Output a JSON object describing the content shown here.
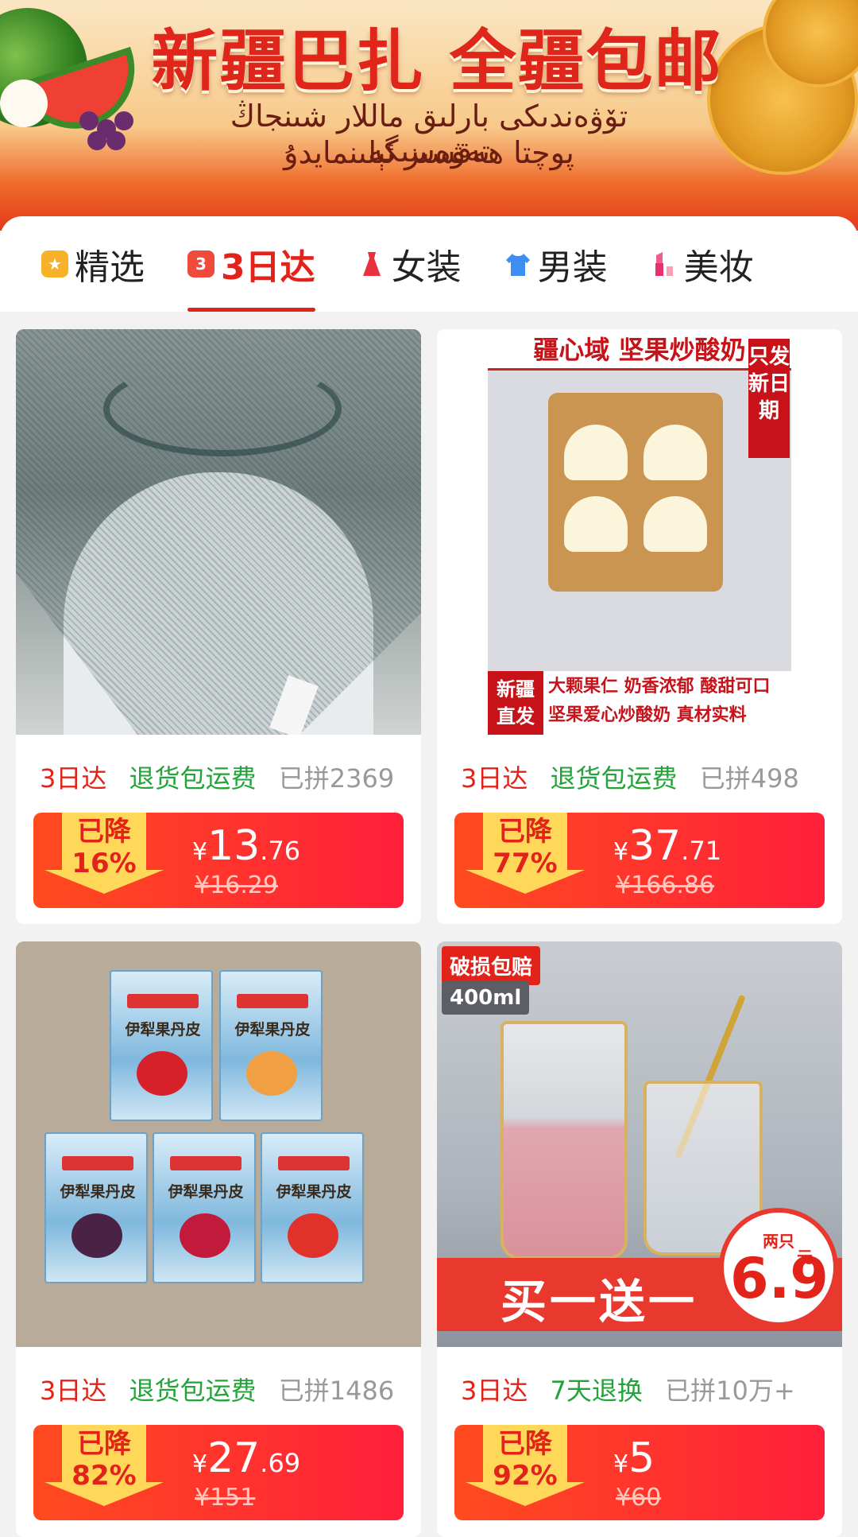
{
  "banner": {
    "title": "新疆巴扎 全疆包邮",
    "uyghur_line1": "تۆۋەندىكى بارلىق ماللار شىنجاڭ تەۋەسىگە",
    "uyghur_line2": "پوچتا ھەقسىز ئېلىنمايدۇ"
  },
  "tabs": [
    {
      "label": "精选",
      "icon": "star-badge-icon"
    },
    {
      "label": "3日达",
      "icon": "calendar-3-icon",
      "icon_text": "3",
      "active": true
    },
    {
      "label": "女装",
      "icon": "dress-icon"
    },
    {
      "label": "男装",
      "icon": "hoodie-icon"
    },
    {
      "label": "美妆",
      "icon": "lipstick-icon"
    }
  ],
  "products": [
    {
      "image_label": "sheer-fabric-scarf",
      "fast_tag": "3日达",
      "service_tag": "退货包运费",
      "sold": "已拼2369",
      "drop_label": "已降",
      "drop_pct": "16%",
      "currency": "¥",
      "price_int": "13",
      "price_dec": ".76",
      "orig_price": "¥16.29"
    },
    {
      "image_label": "nut-fried-yogurt",
      "image_texts": {
        "top": "疆心域 坚果炒酸奶",
        "side": "只发新日期",
        "bottom_left": "新疆直发",
        "bottom_1": "大颗果仁 奶香浓郁 酸甜可口",
        "bottom_2": "坚果爱心炒酸奶 真材实料"
      },
      "fast_tag": "3日达",
      "service_tag": "退货包运费",
      "sold": "已拼498",
      "drop_label": "已降",
      "drop_pct": "77%",
      "currency": "¥",
      "price_int": "37",
      "price_dec": ".71",
      "orig_price": "¥166.86"
    },
    {
      "image_label": "yili-fruit-leather-boxes",
      "image_texts": {
        "box_name": "伊犁果丹皮"
      },
      "fast_tag": "3日达",
      "service_tag": "退货包运费",
      "sold": "已拼1486",
      "drop_label": "已降",
      "drop_pct": "82%",
      "currency": "¥",
      "price_int": "27",
      "price_dec": ".69",
      "orig_price": "¥151"
    },
    {
      "image_label": "hammered-glass-cups",
      "image_texts": {
        "badge1": "破损包赔",
        "badge2": "400ml",
        "promo": "买一送一",
        "circle_top": "两只",
        "circle_price": "6.9",
        "circle_unit": "元"
      },
      "fast_tag": "3日达",
      "service_tag": "7天退换",
      "sold": "已拼10万+",
      "drop_label": "已降",
      "drop_pct": "92%",
      "currency": "¥",
      "price_int": "5",
      "price_dec": "",
      "orig_price": "¥60"
    }
  ],
  "colors": {
    "brand_red": "#e2231a",
    "service_green": "#23a33a",
    "muted": "#999999"
  }
}
